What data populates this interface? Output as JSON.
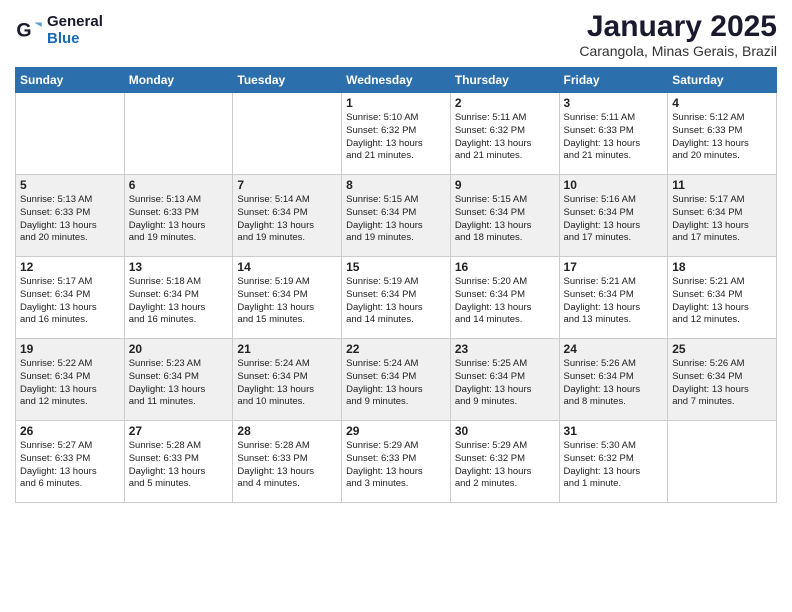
{
  "logo": {
    "general": "General",
    "blue": "Blue"
  },
  "title": "January 2025",
  "subtitle": "Carangola, Minas Gerais, Brazil",
  "weekdays": [
    "Sunday",
    "Monday",
    "Tuesday",
    "Wednesday",
    "Thursday",
    "Friday",
    "Saturday"
  ],
  "weeks": [
    [
      {
        "day": "",
        "info": ""
      },
      {
        "day": "",
        "info": ""
      },
      {
        "day": "",
        "info": ""
      },
      {
        "day": "1",
        "info": "Sunrise: 5:10 AM\nSunset: 6:32 PM\nDaylight: 13 hours\nand 21 minutes."
      },
      {
        "day": "2",
        "info": "Sunrise: 5:11 AM\nSunset: 6:32 PM\nDaylight: 13 hours\nand 21 minutes."
      },
      {
        "day": "3",
        "info": "Sunrise: 5:11 AM\nSunset: 6:33 PM\nDaylight: 13 hours\nand 21 minutes."
      },
      {
        "day": "4",
        "info": "Sunrise: 5:12 AM\nSunset: 6:33 PM\nDaylight: 13 hours\nand 20 minutes."
      }
    ],
    [
      {
        "day": "5",
        "info": "Sunrise: 5:13 AM\nSunset: 6:33 PM\nDaylight: 13 hours\nand 20 minutes."
      },
      {
        "day": "6",
        "info": "Sunrise: 5:13 AM\nSunset: 6:33 PM\nDaylight: 13 hours\nand 19 minutes."
      },
      {
        "day": "7",
        "info": "Sunrise: 5:14 AM\nSunset: 6:34 PM\nDaylight: 13 hours\nand 19 minutes."
      },
      {
        "day": "8",
        "info": "Sunrise: 5:15 AM\nSunset: 6:34 PM\nDaylight: 13 hours\nand 19 minutes."
      },
      {
        "day": "9",
        "info": "Sunrise: 5:15 AM\nSunset: 6:34 PM\nDaylight: 13 hours\nand 18 minutes."
      },
      {
        "day": "10",
        "info": "Sunrise: 5:16 AM\nSunset: 6:34 PM\nDaylight: 13 hours\nand 17 minutes."
      },
      {
        "day": "11",
        "info": "Sunrise: 5:17 AM\nSunset: 6:34 PM\nDaylight: 13 hours\nand 17 minutes."
      }
    ],
    [
      {
        "day": "12",
        "info": "Sunrise: 5:17 AM\nSunset: 6:34 PM\nDaylight: 13 hours\nand 16 minutes."
      },
      {
        "day": "13",
        "info": "Sunrise: 5:18 AM\nSunset: 6:34 PM\nDaylight: 13 hours\nand 16 minutes."
      },
      {
        "day": "14",
        "info": "Sunrise: 5:19 AM\nSunset: 6:34 PM\nDaylight: 13 hours\nand 15 minutes."
      },
      {
        "day": "15",
        "info": "Sunrise: 5:19 AM\nSunset: 6:34 PM\nDaylight: 13 hours\nand 14 minutes."
      },
      {
        "day": "16",
        "info": "Sunrise: 5:20 AM\nSunset: 6:34 PM\nDaylight: 13 hours\nand 14 minutes."
      },
      {
        "day": "17",
        "info": "Sunrise: 5:21 AM\nSunset: 6:34 PM\nDaylight: 13 hours\nand 13 minutes."
      },
      {
        "day": "18",
        "info": "Sunrise: 5:21 AM\nSunset: 6:34 PM\nDaylight: 13 hours\nand 12 minutes."
      }
    ],
    [
      {
        "day": "19",
        "info": "Sunrise: 5:22 AM\nSunset: 6:34 PM\nDaylight: 13 hours\nand 12 minutes."
      },
      {
        "day": "20",
        "info": "Sunrise: 5:23 AM\nSunset: 6:34 PM\nDaylight: 13 hours\nand 11 minutes."
      },
      {
        "day": "21",
        "info": "Sunrise: 5:24 AM\nSunset: 6:34 PM\nDaylight: 13 hours\nand 10 minutes."
      },
      {
        "day": "22",
        "info": "Sunrise: 5:24 AM\nSunset: 6:34 PM\nDaylight: 13 hours\nand 9 minutes."
      },
      {
        "day": "23",
        "info": "Sunrise: 5:25 AM\nSunset: 6:34 PM\nDaylight: 13 hours\nand 9 minutes."
      },
      {
        "day": "24",
        "info": "Sunrise: 5:26 AM\nSunset: 6:34 PM\nDaylight: 13 hours\nand 8 minutes."
      },
      {
        "day": "25",
        "info": "Sunrise: 5:26 AM\nSunset: 6:34 PM\nDaylight: 13 hours\nand 7 minutes."
      }
    ],
    [
      {
        "day": "26",
        "info": "Sunrise: 5:27 AM\nSunset: 6:33 PM\nDaylight: 13 hours\nand 6 minutes."
      },
      {
        "day": "27",
        "info": "Sunrise: 5:28 AM\nSunset: 6:33 PM\nDaylight: 13 hours\nand 5 minutes."
      },
      {
        "day": "28",
        "info": "Sunrise: 5:28 AM\nSunset: 6:33 PM\nDaylight: 13 hours\nand 4 minutes."
      },
      {
        "day": "29",
        "info": "Sunrise: 5:29 AM\nSunset: 6:33 PM\nDaylight: 13 hours\nand 3 minutes."
      },
      {
        "day": "30",
        "info": "Sunrise: 5:29 AM\nSunset: 6:32 PM\nDaylight: 13 hours\nand 2 minutes."
      },
      {
        "day": "31",
        "info": "Sunrise: 5:30 AM\nSunset: 6:32 PM\nDaylight: 13 hours\nand 1 minute."
      },
      {
        "day": "",
        "info": ""
      }
    ]
  ]
}
